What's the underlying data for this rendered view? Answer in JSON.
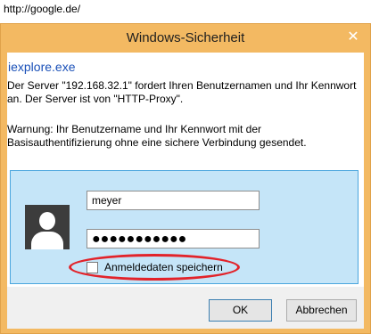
{
  "browser": {
    "url": "http://google.de/"
  },
  "dialog": {
    "title": "Windows-Sicherheit",
    "close_glyph": "✕",
    "app_name": "iexplore.exe",
    "message": "Der Server \"192.168.32.1\" fordert Ihren Benutzernamen und Ihr Kennwort an. Der Server ist von \"HTTP-Proxy\".",
    "warning": "Warnung: Ihr Benutzername und Ihr Kennwort mit der Basisauthentifizierung ohne eine sichere Verbindung gesendet.",
    "credentials": {
      "avatar_icon": "user-icon",
      "username_value": "meyer",
      "password_mask": "●●●●●●●●●●●",
      "remember_label": "Anmeldedaten speichern",
      "remember_checked": false
    },
    "buttons": {
      "ok": "OK",
      "cancel": "Abbrechen"
    }
  },
  "colors": {
    "titlebar": "#f3b962",
    "panel": "#c5e5f8",
    "panel_border": "#4ba6de",
    "highlight": "#e2232a",
    "app_name": "#1a50b8"
  }
}
